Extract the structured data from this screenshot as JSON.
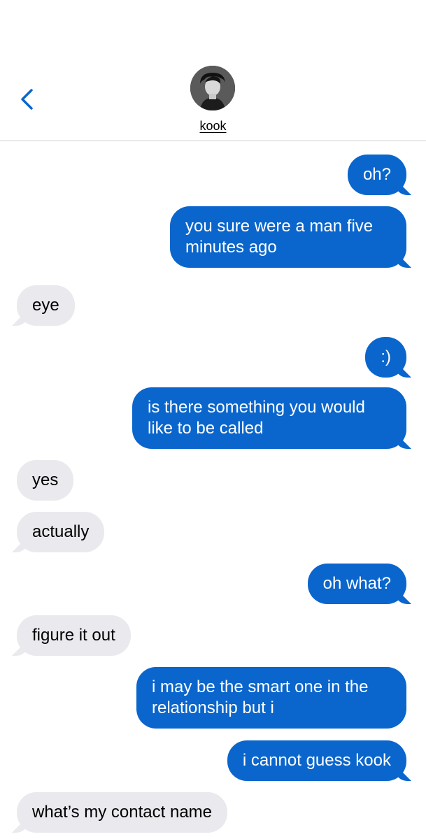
{
  "header": {
    "contact_name": "kook",
    "back_icon": "chevron-left-icon",
    "avatar": "contact-avatar"
  },
  "colors": {
    "outgoing_bubble": "#0a66cc",
    "incoming_bubble": "#e9e9ee",
    "back_chevron": "#0a66cc"
  },
  "messages": [
    {
      "direction": "out",
      "text": "oh?"
    },
    {
      "direction": "out",
      "text": "you sure were a man five minutes ago"
    },
    {
      "direction": "in",
      "text": "eye"
    },
    {
      "direction": "out",
      "text": ":)"
    },
    {
      "direction": "out",
      "text": "is there something you would like to be called"
    },
    {
      "direction": "in",
      "text": "yes"
    },
    {
      "direction": "in",
      "text": "actually"
    },
    {
      "direction": "out",
      "text": "oh what?"
    },
    {
      "direction": "in",
      "text": "figure it out"
    },
    {
      "direction": "out",
      "text": "i may be the smart one in the relationship but i"
    },
    {
      "direction": "out",
      "text": "i cannot guess kook"
    },
    {
      "direction": "in",
      "text": "what’s my contact name"
    }
  ]
}
